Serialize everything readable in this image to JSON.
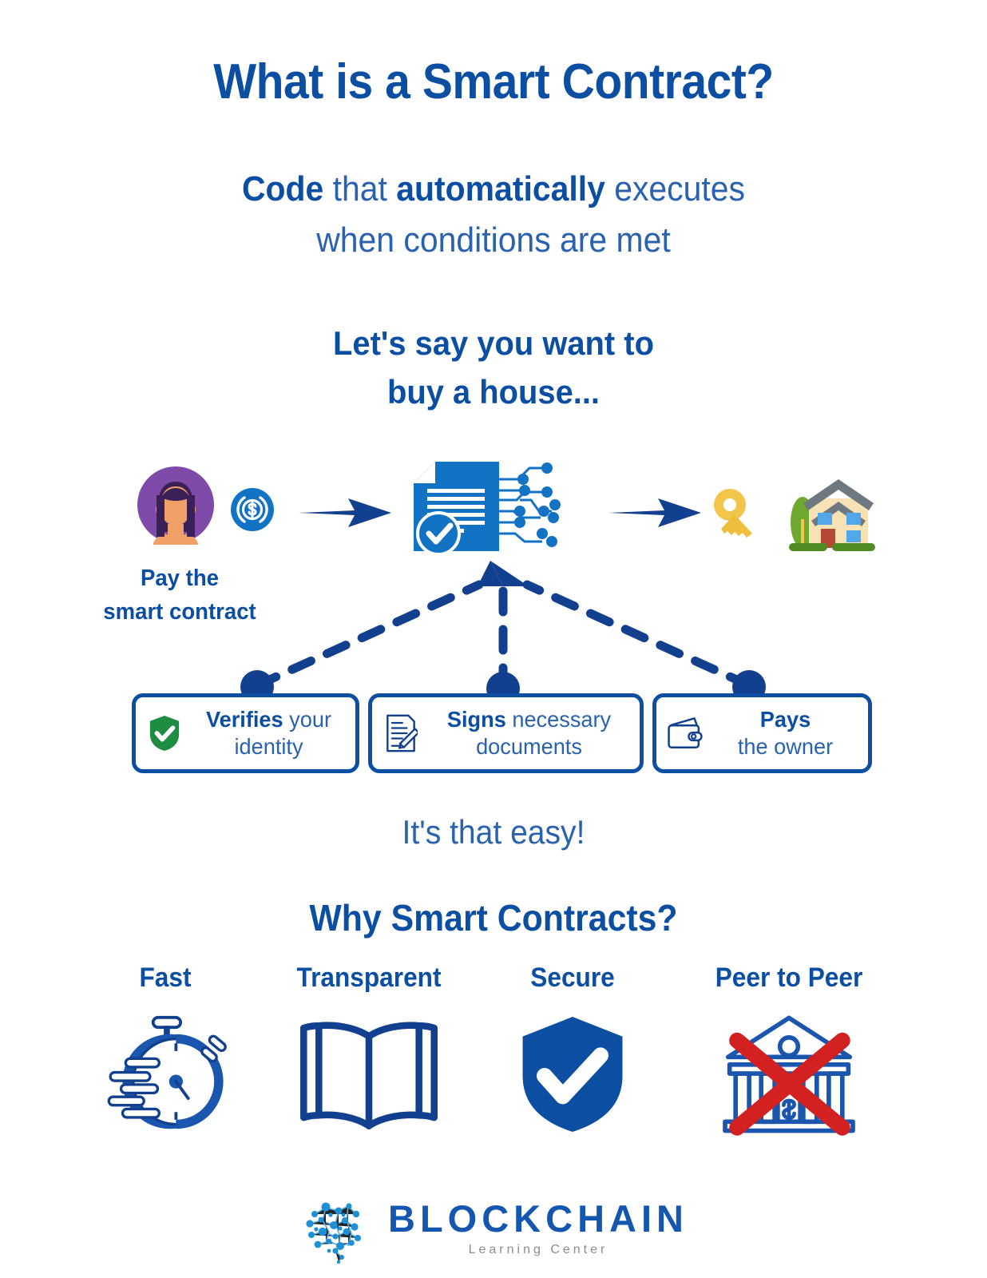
{
  "title": "What is a Smart Contract?",
  "subtitle": {
    "bold1": "Code",
    "plain1": " that ",
    "bold2": "automatically",
    "plain2": " executes",
    "line2": "when conditions are met"
  },
  "scenario": {
    "line1": "Let's say you want to",
    "line2": "buy a house..."
  },
  "flow": {
    "avatar_icon": "person-avatar-icon",
    "coin_icon": "dollar-coin-icon",
    "arrow_left_icon": "arrow-right-icon",
    "contract_icon": "smart-contract-document-icon",
    "arrow_right_icon": "arrow-right-icon",
    "key_icon": "key-icon",
    "house_icon": "house-icon",
    "pay_label_line1": "Pay the",
    "pay_label_line2": "smart contract"
  },
  "actions": [
    {
      "icon": "shield-check-icon",
      "bold": "Verifies",
      "rest": " your",
      "line2": "identity"
    },
    {
      "icon": "document-pen-icon",
      "bold": "Signs",
      "rest": " necessary",
      "line2": "documents"
    },
    {
      "icon": "wallet-icon",
      "bold": "Pays",
      "rest": "",
      "line2": "the owner"
    }
  ],
  "easy_text": "It's that easy!",
  "why_heading": "Why Smart Contracts?",
  "benefits": [
    {
      "label": "Fast",
      "icon": "stopwatch-icon"
    },
    {
      "label": "Transparent",
      "icon": "open-book-icon"
    },
    {
      "label": "Secure",
      "icon": "shield-check-filled-icon"
    },
    {
      "label": "Peer to Peer",
      "icon": "bank-crossed-out-icon"
    }
  ],
  "logo": {
    "mark_icon": "brain-network-logo-icon",
    "name": "BLOCKCHAIN",
    "tagline": "Learning Center"
  },
  "colors": {
    "primary_blue": "#0b4ea2",
    "light_blue": "#2a62b0",
    "icon_blue": "#1272c4",
    "green": "#1e8c41",
    "red": "#d32020",
    "key_yellow": "#f3c64b",
    "avatar_purple": "#7e4ca8"
  }
}
